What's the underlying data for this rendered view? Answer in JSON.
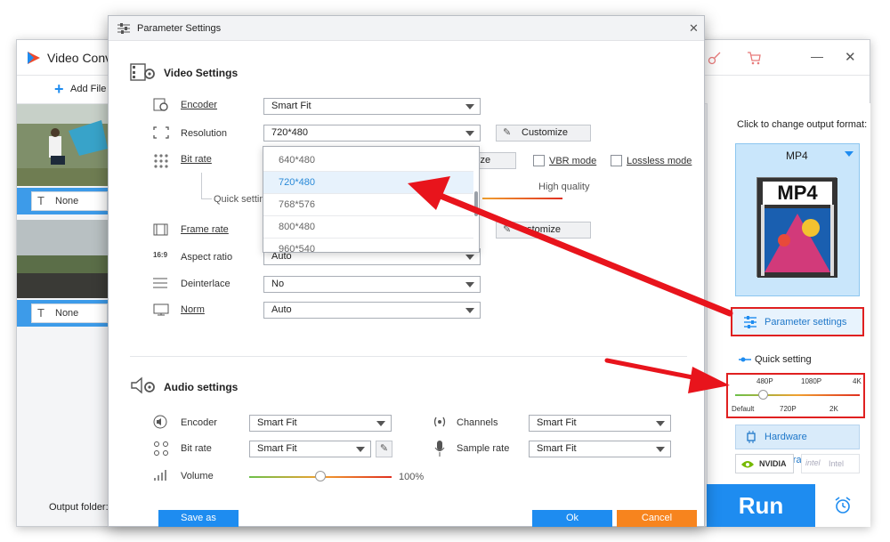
{
  "main_window": {
    "title": "Video Conv",
    "add_files": "Add File",
    "output_folder_label": "Output folder:",
    "files": [
      {
        "subtitle": "None"
      },
      {
        "subtitle": "None"
      }
    ]
  },
  "right_panel": {
    "click_to_change": "Click to change output format:",
    "format_name": "MP4",
    "format_tile_text": "MP4",
    "parameter_settings": "Parameter settings",
    "quick_setting": "Quick setting",
    "quick_top_labels": [
      "480P",
      "1080P",
      "4K"
    ],
    "quick_bottom_labels": [
      "Default",
      "720P",
      "2K"
    ],
    "hardware_acceleration": "Hardware acceleration",
    "gpu_nvidia": "NVIDIA",
    "gpu_intel": "intel",
    "gpu_intel_sub": "Intel",
    "run": "Run"
  },
  "dialog": {
    "title": "Parameter Settings",
    "video_section": "Video Settings",
    "audio_section": "Audio settings",
    "video": {
      "encoder_label": "Encoder",
      "encoder_value": "Smart Fit",
      "resolution_label": "Resolution",
      "resolution_value": "720*480",
      "customize": "Customize",
      "bitrate_label": "Bit rate",
      "bitrate_customize_partial": "ize",
      "vbr_mode": "VBR mode",
      "lossless_mode": "Lossless mode",
      "quick_setting_partial": "Quick setting",
      "high_quality": "High quality",
      "framerate_label": "Frame rate",
      "framerate_customize_partial": "ustomize",
      "aspect_label": "Aspect ratio",
      "aspect_value": "Auto",
      "deinterlace_label": "Deinterlace",
      "deinterlace_value": "No",
      "norm_label": "Norm",
      "norm_value": "Auto"
    },
    "resolution_options": [
      "640*480",
      "720*480",
      "768*576",
      "800*480",
      "960*540"
    ],
    "resolution_selected_index": 1,
    "audio": {
      "encoder_label": "Encoder",
      "encoder_value": "Smart Fit",
      "channels_label": "Channels",
      "channels_value": "Smart Fit",
      "bitrate_label": "Bit rate",
      "bitrate_value": "Smart Fit",
      "samplerate_label": "Sample rate",
      "samplerate_value": "Smart Fit",
      "volume_label": "Volume",
      "volume_value": "100%",
      "volume_level": 0.5
    },
    "buttons": {
      "save_as": "Save as",
      "ok": "Ok",
      "cancel": "Cancel"
    }
  },
  "colors": {
    "accent_blue": "#1e8cf0",
    "cancel_orange": "#f7841e",
    "arrow_red": "#e8141c",
    "highlight_red": "#e02020"
  }
}
